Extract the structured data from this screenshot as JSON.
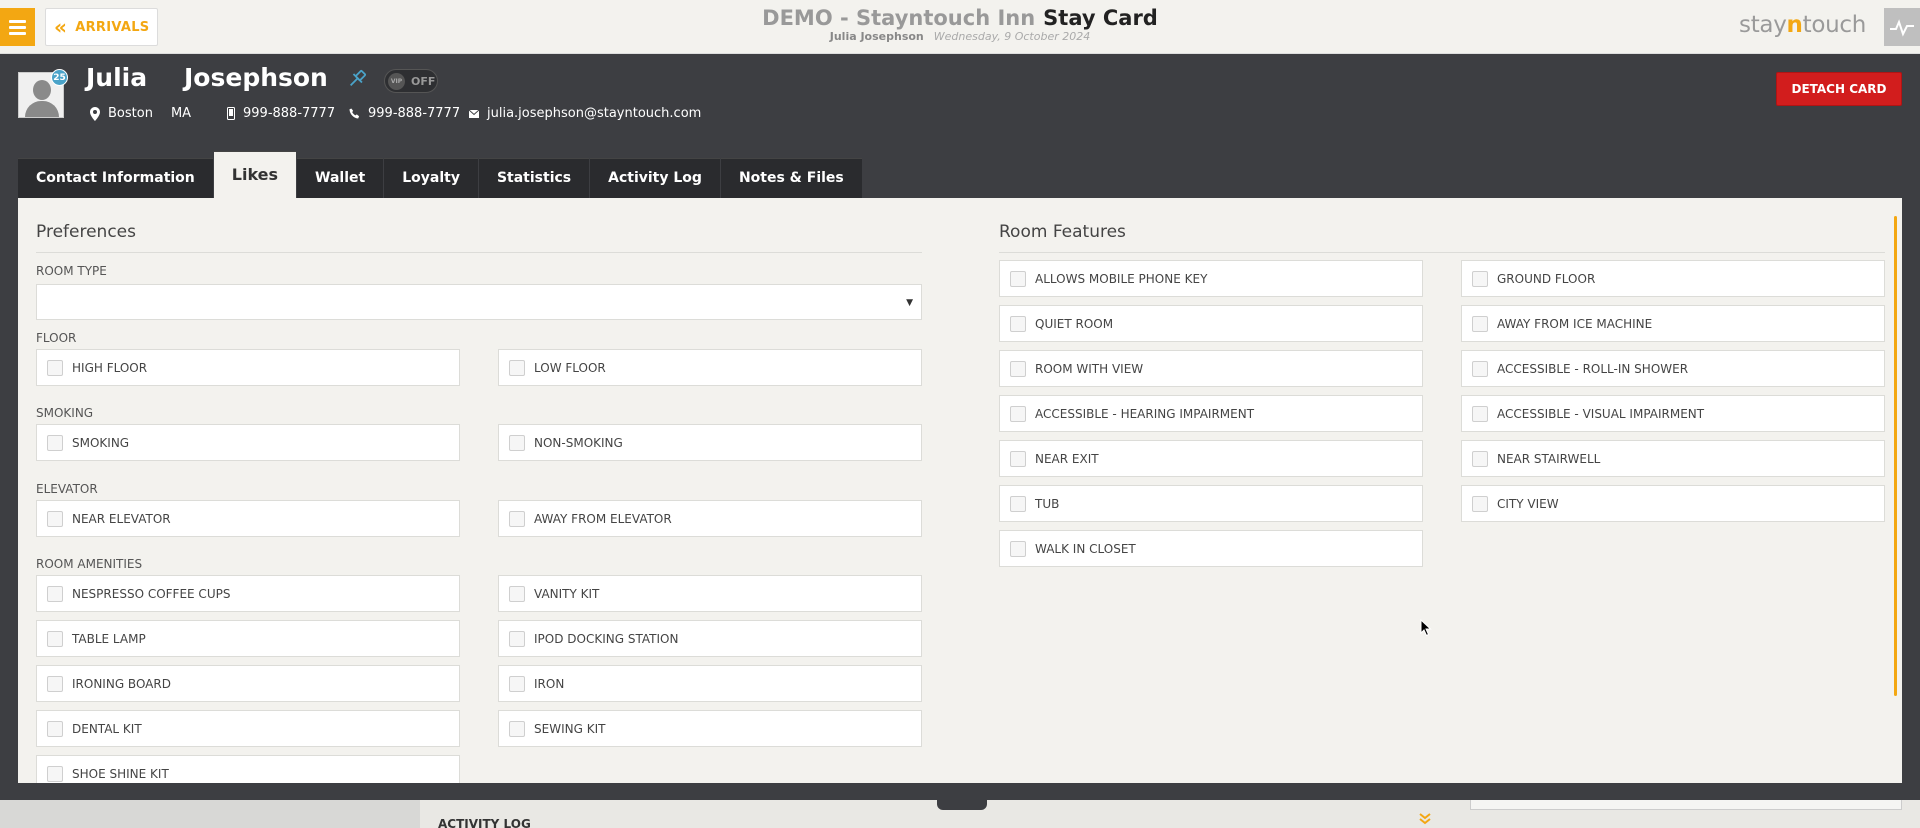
{
  "topbar": {
    "back_label": "ARRIVALS",
    "hotel_title": "DEMO - Stayntouch Inn",
    "page_title": "Stay Card",
    "guest_name": "Julia Josephson",
    "date": "Wednesday, 9 October 2024",
    "brand_prefix": "stay",
    "brand_n": "n",
    "brand_suffix": "touch"
  },
  "guest": {
    "first_name": "Julia",
    "last_name": "Josephson",
    "badge_count": "25",
    "vip_toggle_text": "VIP",
    "vip_status": "OFF",
    "city": "Boston",
    "state": "MA",
    "mobile": "999-888-7777",
    "phone": "999-888-7777",
    "email": "julia.josephson@stayntouch.com",
    "detach_label": "DETACH CARD"
  },
  "tabs": [
    {
      "label": "Contact Information",
      "active": false
    },
    {
      "label": "Likes",
      "active": true
    },
    {
      "label": "Wallet",
      "active": false
    },
    {
      "label": "Loyalty",
      "active": false
    },
    {
      "label": "Statistics",
      "active": false
    },
    {
      "label": "Activity Log",
      "active": false
    },
    {
      "label": "Notes & Files",
      "active": false
    }
  ],
  "preferences": {
    "title": "Preferences",
    "room_type_label": "ROOM TYPE",
    "room_type_value": "",
    "floor_label": "FLOOR",
    "floor": [
      "HIGH FLOOR",
      "LOW FLOOR"
    ],
    "smoking_label": "SMOKING",
    "smoking": [
      "SMOKING",
      "NON-SMOKING"
    ],
    "elevator_label": "ELEVATOR",
    "elevator": [
      "NEAR ELEVATOR",
      "AWAY FROM ELEVATOR"
    ],
    "amenities_label": "ROOM AMENITIES",
    "amenities": [
      "NESPRESSO COFFEE CUPS",
      "VANITY KIT",
      "TABLE LAMP",
      "IPOD DOCKING STATION",
      "IRONING BOARD",
      "IRON",
      "DENTAL KIT",
      "SEWING KIT",
      "SHOE SHINE KIT"
    ]
  },
  "room_features": {
    "title": "Room Features",
    "items": [
      "ALLOWS MOBILE PHONE KEY",
      "GROUND FLOOR",
      "QUIET ROOM",
      "AWAY FROM ICE MACHINE",
      "ROOM WITH VIEW",
      "ACCESSIBLE - ROLL-IN SHOWER",
      "ACCESSIBLE - HEARING IMPAIRMENT",
      "ACCESSIBLE - VISUAL IMPAIRMENT",
      "NEAR EXIT",
      "NEAR STAIRWELL",
      "TUB",
      "CITY VIEW",
      "WALK IN CLOSET"
    ]
  },
  "bottom": {
    "activity_log_label": "ACTIVITY LOG"
  },
  "colors": {
    "accent": "#f3a712",
    "detach": "#d21d1d",
    "header_bg": "#3d3e42",
    "panel_bg": "#f3f2ee"
  }
}
